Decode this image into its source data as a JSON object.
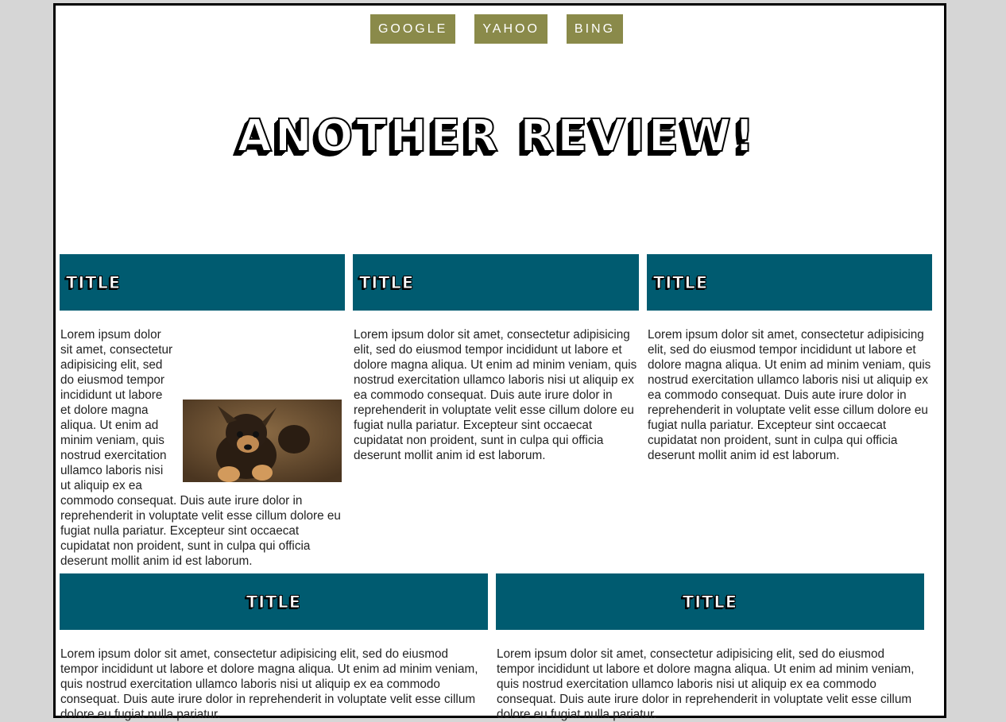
{
  "nav": {
    "items": [
      "GOOGLE",
      "YAHOO",
      "BING"
    ]
  },
  "hero": {
    "title": "Another Review!"
  },
  "cards_row1": [
    {
      "title": "Title",
      "body": "Lorem ipsum dolor sit amet, consectetur adipisicing elit, sed do eiusmod tempor incididunt ut labore et dolore magna aliqua. Ut enim ad minim veniam, quis nostrud exercitation ullamco laboris nisi ut aliquip ex ea commodo consequat. Duis aute irure dolor in reprehenderit in voluptate velit esse cillum dolore eu fugiat nulla pariatur. Excepteur sint occaecat cupidatat non proident, sunt in culpa qui officia deserunt mollit anim id est laborum."
    },
    {
      "title": "Title",
      "body": "Lorem ipsum dolor sit amet, consectetur adipisicing elit, sed do eiusmod tempor incididunt ut labore et dolore magna aliqua. Ut enim ad minim veniam, quis nostrud exercitation ullamco laboris nisi ut aliquip ex ea commodo consequat. Duis aute irure dolor in reprehenderit in voluptate velit esse cillum dolore eu fugiat nulla pariatur. Excepteur sint occaecat cupidatat non proident, sunt in culpa qui officia deserunt mollit anim id est laborum."
    },
    {
      "title": "Title",
      "body": "Lorem ipsum dolor sit amet, consectetur adipisicing elit, sed do eiusmod tempor incididunt ut labore et dolore magna aliqua. Ut enim ad minim veniam, quis nostrud exercitation ullamco laboris nisi ut aliquip ex ea commodo consequat. Duis aute irure dolor in reprehenderit in voluptate velit esse cillum dolore eu fugiat nulla pariatur. Excepteur sint occaecat cupidatat non proident, sunt in culpa qui officia deserunt mollit anim id est laborum."
    }
  ],
  "cards_row2": [
    {
      "title": "Title",
      "body": "Lorem ipsum dolor sit amet, consectetur adipisicing elit, sed do eiusmod tempor incididunt ut labore et dolore magna aliqua. Ut enim ad minim veniam, quis nostrud exercitation ullamco laboris nisi ut aliquip ex ea commodo consequat. Duis aute irure dolor in reprehenderit in voluptate velit esse cillum dolore eu fugiat nulla pariatur."
    },
    {
      "title": "Title",
      "body": "Lorem ipsum dolor sit amet, consectetur adipisicing elit, sed do eiusmod tempor incididunt ut labore et dolore magna aliqua. Ut enim ad minim veniam, quis nostrud exercitation ullamco laboris nisi ut aliquip ex ea commodo consequat. Duis aute irure dolor in reprehenderit in voluptate velit esse cillum dolore eu fugiat nulla pariatur."
    }
  ],
  "colors": {
    "nav_button": "#8a8a4a",
    "card_header": "#005b70",
    "page_bg": "#ffffff",
    "outer_bg": "#d6d6d6"
  }
}
